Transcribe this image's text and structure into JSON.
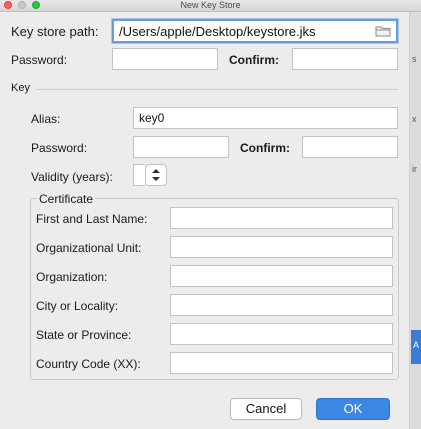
{
  "window": {
    "title": "New Key Store"
  },
  "keystore": {
    "path_label": "Key store path:",
    "path_value": "/Users/apple/Desktop/keystore.jks",
    "password_label": "Password:",
    "password_value": "",
    "confirm_label": "Confirm:",
    "confirm_value": ""
  },
  "key": {
    "section_label": "Key",
    "alias_label": "Alias:",
    "alias_value": "key0",
    "password_label": "Password:",
    "password_value": "",
    "confirm_label": "Confirm:",
    "confirm_value": "",
    "validity_label": "Validity (years):",
    "validity_value": ""
  },
  "certificate": {
    "group_label": "Certificate",
    "fields": [
      {
        "label": "First and Last Name:",
        "value": ""
      },
      {
        "label": "Organizational Unit:",
        "value": ""
      },
      {
        "label": "Organization:",
        "value": ""
      },
      {
        "label": "City or Locality:",
        "value": ""
      },
      {
        "label": "State or Province:",
        "value": ""
      },
      {
        "label": "Country Code (XX):",
        "value": ""
      }
    ]
  },
  "buttons": {
    "cancel": "Cancel",
    "ok": "OK"
  },
  "background_fragments": [
    "s",
    "x",
    "ir",
    "A"
  ],
  "colors": {
    "accent": "#3d87e4",
    "focus_ring": "#6b9ad6",
    "window_bg": "#ececec"
  },
  "icons": {
    "folder": "folder-icon",
    "spinner": "up-down-arrows-icon"
  }
}
